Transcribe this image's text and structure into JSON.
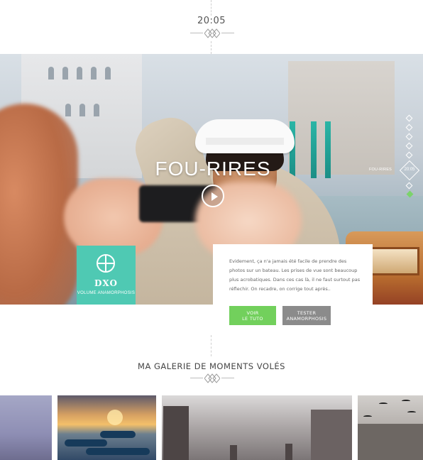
{
  "header": {
    "time": "20:05"
  },
  "hero": {
    "title": "FOU-RIRES",
    "description": "Evidement, ça n'a jamais été facile de prendre des photos sur un bateau. Les prises de vue sont beaucoup plus acrobatiques. Dans ces cas là, il ne faut surtout pas réflechir. On recadre, on corrige tout après..",
    "brand": {
      "name": "DXO",
      "subtitle": "VOLUME ANAMORPHOSIS"
    },
    "nav": {
      "active_label": "FOU-RIRES",
      "active_time": "20:05"
    }
  },
  "actions": {
    "primary": "VOIR\nLE TUTO",
    "secondary": "TESTER\nANAMORPHOSIS"
  },
  "gallery": {
    "title": "MA GALERIE DE MOMENTS VOLÉS"
  },
  "colors": {
    "accent_green": "#72d05c",
    "brand_teal": "#4fc9b3",
    "secondary_gray": "#8b8b8b"
  },
  "icons": [
    "diamond-divider-icon",
    "play-icon",
    "dxo-logo-icon",
    "nav-diamond-icon"
  ]
}
